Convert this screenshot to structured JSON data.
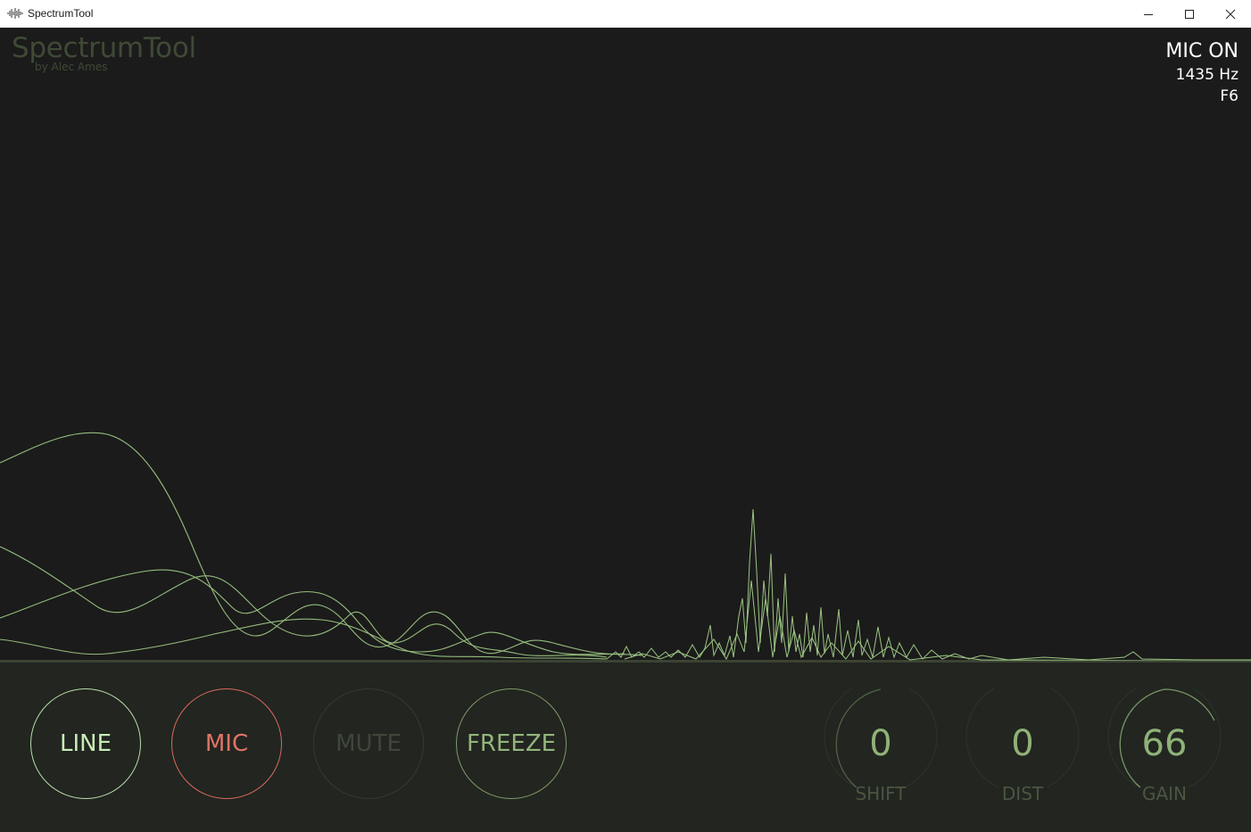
{
  "window": {
    "title": "SpectrumTool"
  },
  "brand": {
    "title": "SpectrumTool",
    "subtitle": "by Alec Ames"
  },
  "status": {
    "mic": "MIC ON",
    "frequency": "1435 Hz",
    "note": "F6"
  },
  "buttons": {
    "line": "LINE",
    "mic": "MIC",
    "mute": "MUTE",
    "freeze": "FREEZE"
  },
  "knobs": {
    "shift": {
      "value": "0",
      "label": "SHIFT"
    },
    "dist": {
      "value": "0",
      "label": "DIST"
    },
    "gain": {
      "value": "66",
      "label": "GAIN"
    }
  },
  "colors": {
    "background": "#1b1b1b",
    "panel": "#222520",
    "accent_green": "#8fb277",
    "mic_red": "#e07467",
    "line_green": "#c7ecb6",
    "spectrum_line": "#9cc582"
  }
}
